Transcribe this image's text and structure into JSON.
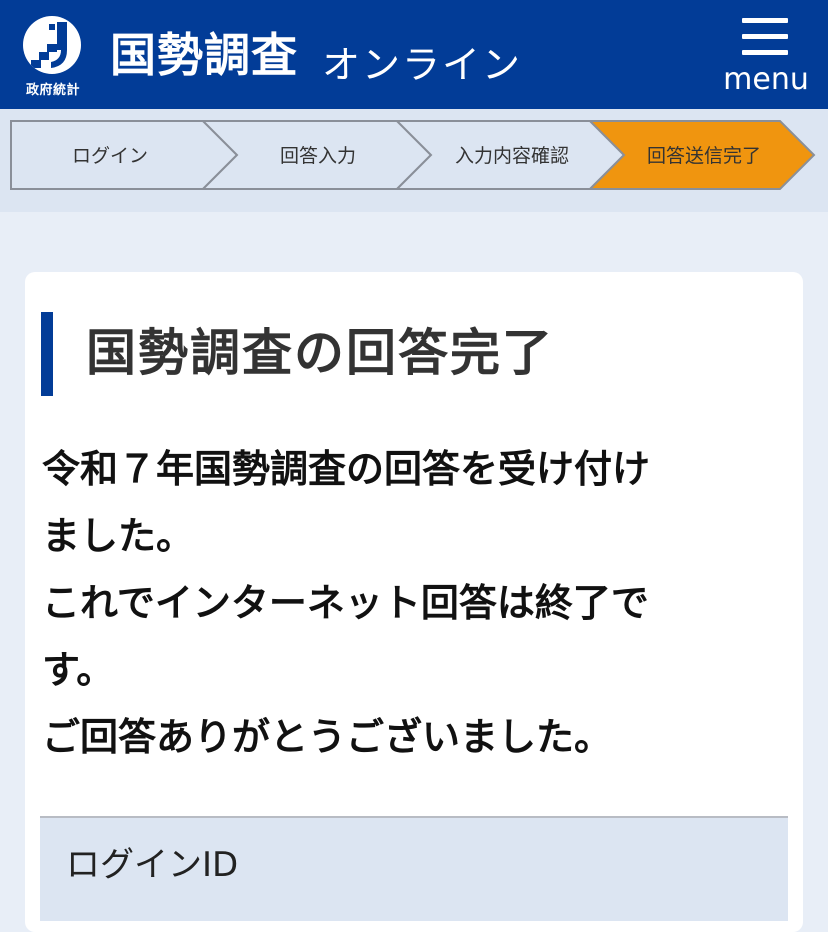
{
  "header": {
    "logo_caption": "政府統計",
    "title": "国勢調査",
    "subtitle": "オンライン",
    "menu_label": "menu",
    "brand_color": "#023c97"
  },
  "steps": {
    "items": [
      {
        "label": "ログイン",
        "state": "done"
      },
      {
        "label": "回答入力",
        "state": "done"
      },
      {
        "label": "入力内容確認",
        "state": "done"
      },
      {
        "label": "回答送信完了",
        "state": "current"
      }
    ],
    "current_color": "#f0950f"
  },
  "main": {
    "title": "国勢調査の回答完了",
    "message_lines": [
      "令和７年国勢調査の回答を受け付け",
      "ました。",
      "これでインターネット回答は終了で",
      "す。",
      "ご回答ありがとうございました。"
    ],
    "login_id_label": "ログインID"
  }
}
